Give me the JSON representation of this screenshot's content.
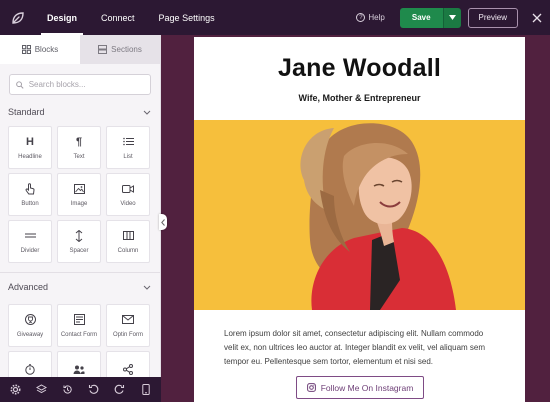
{
  "topbar": {
    "tabs": [
      {
        "label": "Design"
      },
      {
        "label": "Connect"
      },
      {
        "label": "Page Settings"
      }
    ],
    "help_label": "Help",
    "save_label": "Save",
    "preview_label": "Preview"
  },
  "sidebar": {
    "tabs": [
      {
        "label": "Blocks"
      },
      {
        "label": "Sections"
      }
    ],
    "search_placeholder": "Search blocks...",
    "standard": {
      "title": "Standard",
      "blocks": [
        {
          "label": "Headline",
          "icon": "heading-icon",
          "glyph": "H"
        },
        {
          "label": "Text",
          "icon": "paragraph-icon",
          "glyph": "¶"
        },
        {
          "label": "List",
          "icon": "list-icon"
        },
        {
          "label": "Button",
          "icon": "pointer-icon"
        },
        {
          "label": "Image",
          "icon": "image-icon"
        },
        {
          "label": "Video",
          "icon": "video-icon"
        },
        {
          "label": "Divider",
          "icon": "divider-icon"
        },
        {
          "label": "Spacer",
          "icon": "spacer-icon"
        },
        {
          "label": "Column",
          "icon": "column-icon"
        }
      ]
    },
    "advanced": {
      "title": "Advanced",
      "blocks": [
        {
          "label": "Giveaway",
          "icon": "trophy-icon"
        },
        {
          "label": "Contact Form",
          "icon": "form-icon"
        },
        {
          "label": "Optin Form",
          "icon": "envelope-icon"
        },
        {
          "label": "",
          "icon": "stopwatch-icon"
        },
        {
          "label": "",
          "icon": "users-icon"
        },
        {
          "label": "",
          "icon": "share-icon"
        }
      ]
    }
  },
  "bottombar": {
    "icons": [
      "gear-icon",
      "layers-icon",
      "history-icon",
      "undo-icon",
      "redo-icon",
      "mobile-icon"
    ]
  },
  "page": {
    "name": "Jane Woodall",
    "subtitle": "Wife, Mother & Entrepreneur",
    "body": "Lorem ipsum dolor sit amet, consectetur adipiscing elit. Nullam commodo velit ex, non ultrices leo auctor at. Integer blandit ex velit, vel aliquam sem tempor eu. Pellentesque sem tortor, elementum et nisi sed.",
    "instagram_button": "Follow Me On Instagram"
  },
  "colors": {
    "topbar": "#2c1833",
    "canvas": "#51213f",
    "save": "#1f8a4c",
    "hero_background": "#f6bf3c"
  }
}
